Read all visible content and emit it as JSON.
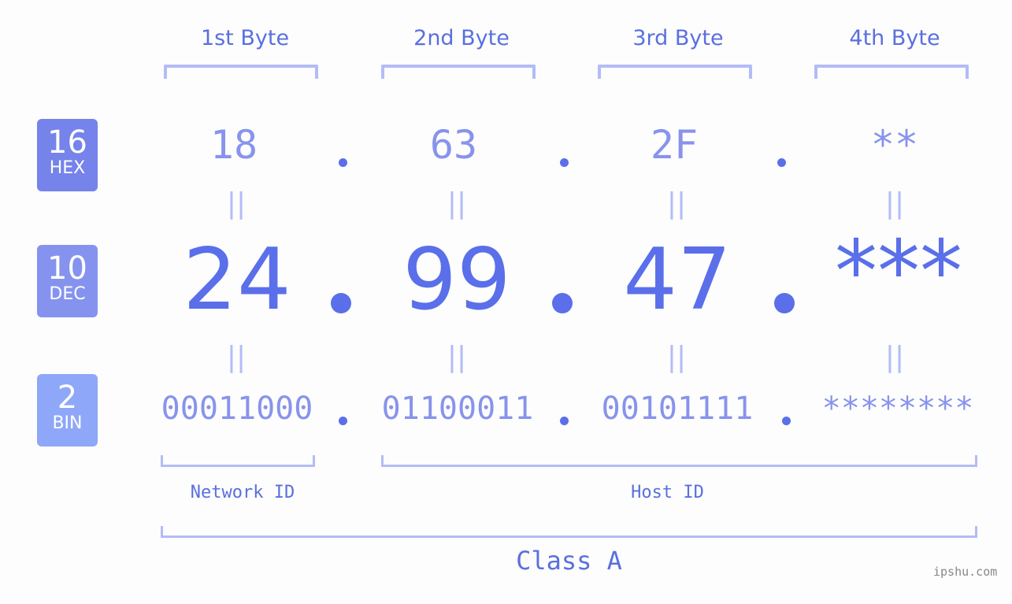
{
  "bytes": [
    {
      "header": "1st Byte",
      "hex": "18",
      "dec": "24",
      "bin": "00011000"
    },
    {
      "header": "2nd Byte",
      "hex": "63",
      "dec": "99",
      "bin": "01100011"
    },
    {
      "header": "3rd Byte",
      "hex": "2F",
      "dec": "47",
      "bin": "00101111"
    },
    {
      "header": "4th Byte",
      "hex": "**",
      "dec": "***",
      "bin": "********"
    }
  ],
  "bases": {
    "hex": {
      "number": "16",
      "label": "HEX",
      "color": "#7583ea"
    },
    "dec": {
      "number": "10",
      "label": "DEC",
      "color": "#8593ef"
    },
    "bin": {
      "number": "2",
      "label": "BIN",
      "color": "#8ea7f8"
    }
  },
  "equals_symbol": "||",
  "segments": {
    "network": "Network ID",
    "host": "Host ID",
    "class": "Class A"
  },
  "watermark": "ipshu.com"
}
